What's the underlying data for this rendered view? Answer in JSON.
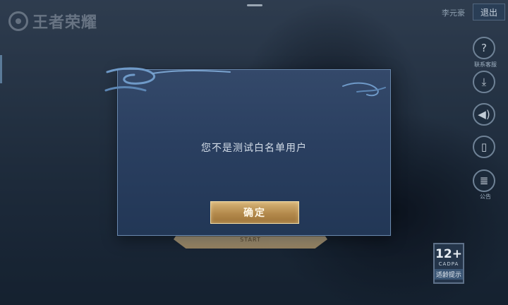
{
  "header": {
    "logo_text": "王者荣耀",
    "username": "李元豪",
    "logout_label": "退出"
  },
  "sidebar": {
    "items": [
      {
        "icon": "question-icon",
        "glyph": "?",
        "label": "联系客服"
      },
      {
        "icon": "download-icon",
        "glyph": "⤓",
        "label": ""
      },
      {
        "icon": "speaker-icon",
        "glyph": "◀)",
        "label": ""
      },
      {
        "icon": "phone-icon",
        "glyph": "▯",
        "label": ""
      },
      {
        "icon": "notice-icon",
        "glyph": "≣",
        "label": "公告"
      }
    ]
  },
  "start_button": {
    "label": "START"
  },
  "age_rating": {
    "number": "12+",
    "org": "CADPA",
    "tip": "适龄提示"
  },
  "dialog": {
    "message": "您不是测试白名单用户",
    "confirm_label": "确定"
  },
  "colors": {
    "dialog_bg": "#2a3f60",
    "dialog_border": "#6a89ad",
    "button_gold": "#b48a4c"
  }
}
